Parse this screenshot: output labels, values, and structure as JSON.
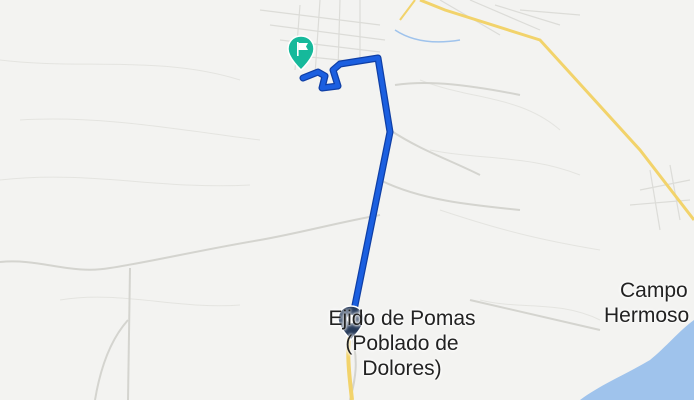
{
  "map": {
    "places": [
      {
        "line1": "Ejido de Pomas",
        "line2": "(Poblado de",
        "line3": "Dolores)"
      },
      {
        "line1": "Campo",
        "line2": "Hermoso"
      }
    ],
    "route": {
      "color": "#1b5fe0",
      "casing_color": "#0f3fa6"
    },
    "markers": [
      {
        "name": "destination",
        "icon": "flag-icon",
        "color": "#16b99b"
      },
      {
        "name": "origin",
        "icon": "navigation-pin-icon",
        "color": "#263a5a"
      }
    ],
    "colors": {
      "land": "#f3f3f1",
      "water": "#9fc3ec",
      "highway": "#f2d36b",
      "minor_road": "#dadad6"
    }
  }
}
